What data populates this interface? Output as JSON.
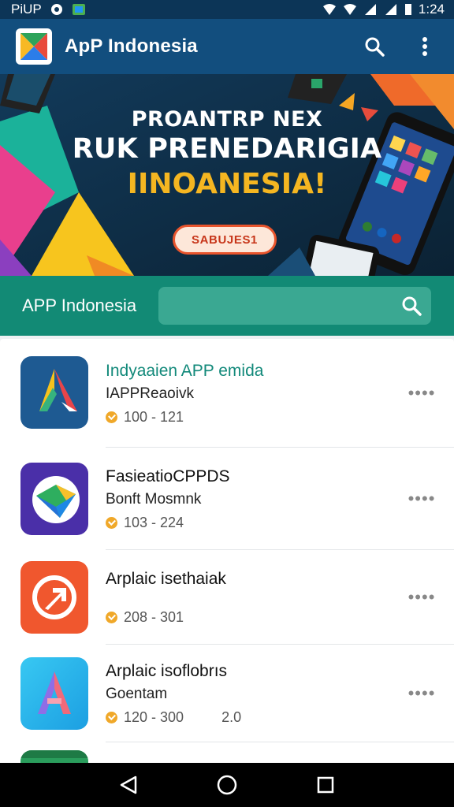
{
  "status_bar": {
    "left_text": "PiUP",
    "time": "1:24"
  },
  "app_bar": {
    "title": "ApP Indonesia",
    "icons": [
      "app-logo",
      "search-icon",
      "more-vert-icon"
    ]
  },
  "banner": {
    "line1": "PROANTRP NEX",
    "line2": "RUK PRENEDARIGIA",
    "line3": "IINOANESIA!",
    "cta_label": "SABUJES1"
  },
  "search_band": {
    "title": "APP Indonesia",
    "search_placeholder": ""
  },
  "apps": [
    {
      "title": "Indyaaien APP emida",
      "subtitle": "IAPPReaoivk",
      "rating_text": "100 - 121",
      "extra": "",
      "more": "••••"
    },
    {
      "title": "FasieatioCPPDS",
      "subtitle": "Bonft Mosmnk",
      "rating_text": "103 - 224",
      "extra": "",
      "more": "••••"
    },
    {
      "title": "Arplaic isethaiak",
      "subtitle": "",
      "rating_text": "208 - 301",
      "extra": "",
      "more": "••••"
    },
    {
      "title": "Arplaic isoflobrıs",
      "subtitle": "Goentam",
      "rating_text": "120 - 300",
      "extra": "2.0",
      "more": "••••"
    }
  ],
  "colors": {
    "status_bar": "#0c3557",
    "app_bar": "#124e7e",
    "search_band": "#128a75",
    "accent_teal": "#12897a",
    "rating": "#f0a829"
  }
}
